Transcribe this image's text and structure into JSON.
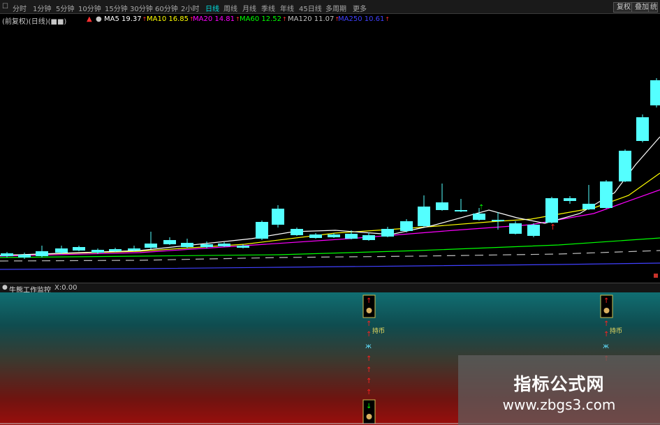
{
  "toolbar": {
    "periods": [
      "分时",
      "1分钟",
      "5分钟",
      "10分钟",
      "15分钟",
      "30分钟",
      "60分钟",
      "2小时",
      "日线",
      "周线",
      "月线",
      "季线",
      "年线",
      "45日线",
      "多周期",
      "更多"
    ],
    "active_period": "日线",
    "right_buttons": [
      "复权",
      "叠加",
      "统计"
    ]
  },
  "legend": {
    "title": "(前复权)(日线)(■■)",
    "items": [
      {
        "name": "MA5",
        "value": "19.37",
        "color": "#ffffff"
      },
      {
        "name": "MA10",
        "value": "16.85",
        "color": "#ffff00"
      },
      {
        "name": "MA20",
        "value": "14.81",
        "color": "#ff00ff"
      },
      {
        "name": "MA60",
        "value": "12.52",
        "color": "#00ff00"
      },
      {
        "name": "MA120",
        "value": "11.07",
        "color": "#c0c0c0"
      },
      {
        "name": "MA250",
        "value": "10.61",
        "color": "#4040ff"
      }
    ]
  },
  "sub_chart": {
    "title": "牛熊工作监控",
    "params": "X:0.00",
    "signal_label": "持币"
  },
  "watermark": {
    "name": "指标公式网",
    "url": "www.zbgs3.com"
  },
  "colors": {
    "up": "#c8322a",
    "down": "#54ffff",
    "background": "#000000",
    "ma5": "#ffffff",
    "ma10": "#ffff00",
    "ma20": "#ff00ff",
    "ma60": "#00ff00",
    "ma120": "#c0c0c0",
    "ma250": "#4040ff"
  }
}
